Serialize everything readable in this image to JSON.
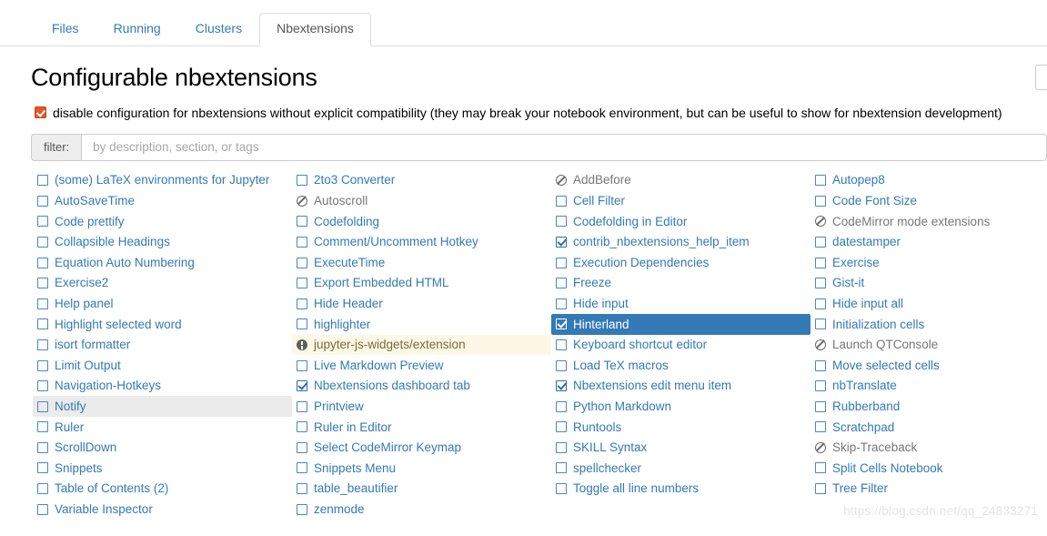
{
  "tabs": [
    {
      "label": "Files",
      "active": false
    },
    {
      "label": "Running",
      "active": false
    },
    {
      "label": "Clusters",
      "active": false
    },
    {
      "label": "Nbextensions",
      "active": true
    }
  ],
  "page": {
    "title": "Configurable nbextensions",
    "disable_config_label": "disable configuration for nbextensions without explicit compatibility (they may break your notebook environment, but can be useful to show for nbextension development)",
    "disable_config_checked": true
  },
  "filter": {
    "addon_label": "filter:",
    "placeholder": "by description, section, or tags",
    "value": ""
  },
  "colors": {
    "link": "#337ab7",
    "selected_bg": "#337ab7",
    "selected_fg": "#ffffff",
    "hover_bg": "#ebebeb",
    "warning_bg": "#fdf8e6",
    "orange_checkbox": "#e8562a",
    "incompatible_fg": "#777777"
  },
  "columns": [
    [
      {
        "label": "(some) LaTeX environments for Jupyter",
        "icon": "unchecked-box-icon",
        "state": "normal"
      },
      {
        "label": "AutoSaveTime",
        "icon": "unchecked-box-icon",
        "state": "normal"
      },
      {
        "label": "Code prettify",
        "icon": "unchecked-box-icon",
        "state": "normal"
      },
      {
        "label": "Collapsible Headings",
        "icon": "unchecked-box-icon",
        "state": "normal"
      },
      {
        "label": "Equation Auto Numbering",
        "icon": "unchecked-box-icon",
        "state": "normal"
      },
      {
        "label": "Exercise2",
        "icon": "unchecked-box-icon",
        "state": "normal"
      },
      {
        "label": "Help panel",
        "icon": "unchecked-box-icon",
        "state": "normal"
      },
      {
        "label": "Highlight selected word",
        "icon": "unchecked-box-icon",
        "state": "normal"
      },
      {
        "label": "isort formatter",
        "icon": "unchecked-box-icon",
        "state": "normal"
      },
      {
        "label": "Limit Output",
        "icon": "unchecked-box-icon",
        "state": "normal"
      },
      {
        "label": "Navigation-Hotkeys",
        "icon": "unchecked-box-icon",
        "state": "normal"
      },
      {
        "label": "Notify",
        "icon": "unchecked-box-icon",
        "state": "hovered"
      },
      {
        "label": "Ruler",
        "icon": "unchecked-box-icon",
        "state": "normal"
      },
      {
        "label": "ScrollDown",
        "icon": "unchecked-box-icon",
        "state": "normal"
      },
      {
        "label": "Snippets",
        "icon": "unchecked-box-icon",
        "state": "normal"
      },
      {
        "label": "Table of Contents (2)",
        "icon": "unchecked-box-icon",
        "state": "normal"
      },
      {
        "label": "Variable Inspector",
        "icon": "unchecked-box-icon",
        "state": "normal"
      }
    ],
    [
      {
        "label": "2to3 Converter",
        "icon": "unchecked-box-icon",
        "state": "normal"
      },
      {
        "label": "Autoscroll",
        "icon": "blocked-icon",
        "state": "incompatible"
      },
      {
        "label": "Codefolding",
        "icon": "unchecked-box-icon",
        "state": "normal"
      },
      {
        "label": "Comment/Uncomment Hotkey",
        "icon": "unchecked-box-icon",
        "state": "normal"
      },
      {
        "label": "ExecuteTime",
        "icon": "unchecked-box-icon",
        "state": "normal"
      },
      {
        "label": "Export Embedded HTML",
        "icon": "unchecked-box-icon",
        "state": "normal"
      },
      {
        "label": "Hide Header",
        "icon": "unchecked-box-icon",
        "state": "normal"
      },
      {
        "label": "highlighter",
        "icon": "unchecked-box-icon",
        "state": "normal"
      },
      {
        "label": "jupyter-js-widgets/extension",
        "icon": "warning-icon",
        "state": "warning"
      },
      {
        "label": "Live Markdown Preview",
        "icon": "unchecked-box-icon",
        "state": "normal"
      },
      {
        "label": "Nbextensions dashboard tab",
        "icon": "checked-box-icon",
        "state": "normal"
      },
      {
        "label": "Printview",
        "icon": "unchecked-box-icon",
        "state": "normal"
      },
      {
        "label": "Ruler in Editor",
        "icon": "unchecked-box-icon",
        "state": "normal"
      },
      {
        "label": "Select CodeMirror Keymap",
        "icon": "unchecked-box-icon",
        "state": "normal"
      },
      {
        "label": "Snippets Menu",
        "icon": "unchecked-box-icon",
        "state": "normal"
      },
      {
        "label": "table_beautifier",
        "icon": "unchecked-box-icon",
        "state": "normal"
      },
      {
        "label": "zenmode",
        "icon": "unchecked-box-icon",
        "state": "normal"
      }
    ],
    [
      {
        "label": "AddBefore",
        "icon": "blocked-icon",
        "state": "incompatible"
      },
      {
        "label": "Cell Filter",
        "icon": "unchecked-box-icon",
        "state": "normal"
      },
      {
        "label": "Codefolding in Editor",
        "icon": "unchecked-box-icon",
        "state": "normal"
      },
      {
        "label": "contrib_nbextensions_help_item",
        "icon": "checked-box-icon",
        "state": "normal"
      },
      {
        "label": "Execution Dependencies",
        "icon": "unchecked-box-icon",
        "state": "normal"
      },
      {
        "label": "Freeze",
        "icon": "unchecked-box-icon",
        "state": "normal"
      },
      {
        "label": "Hide input",
        "icon": "unchecked-box-icon",
        "state": "normal"
      },
      {
        "label": "Hinterland",
        "icon": "checked-box-icon",
        "state": "selected"
      },
      {
        "label": "Keyboard shortcut editor",
        "icon": "unchecked-box-icon",
        "state": "normal"
      },
      {
        "label": "Load TeX macros",
        "icon": "unchecked-box-icon",
        "state": "normal"
      },
      {
        "label": "Nbextensions edit menu item",
        "icon": "checked-box-icon",
        "state": "normal"
      },
      {
        "label": "Python Markdown",
        "icon": "unchecked-box-icon",
        "state": "normal"
      },
      {
        "label": "Runtools",
        "icon": "unchecked-box-icon",
        "state": "normal"
      },
      {
        "label": "SKILL Syntax",
        "icon": "unchecked-box-icon",
        "state": "normal"
      },
      {
        "label": "spellchecker",
        "icon": "unchecked-box-icon",
        "state": "normal"
      },
      {
        "label": "Toggle all line numbers",
        "icon": "unchecked-box-icon",
        "state": "normal"
      }
    ],
    [
      {
        "label": "Autopep8",
        "icon": "unchecked-box-icon",
        "state": "normal"
      },
      {
        "label": "Code Font Size",
        "icon": "unchecked-box-icon",
        "state": "normal"
      },
      {
        "label": "CodeMirror mode extensions",
        "icon": "blocked-icon",
        "state": "incompatible"
      },
      {
        "label": "datestamper",
        "icon": "unchecked-box-icon",
        "state": "normal"
      },
      {
        "label": "Exercise",
        "icon": "unchecked-box-icon",
        "state": "normal"
      },
      {
        "label": "Gist-it",
        "icon": "unchecked-box-icon",
        "state": "normal"
      },
      {
        "label": "Hide input all",
        "icon": "unchecked-box-icon",
        "state": "normal"
      },
      {
        "label": "Initialization cells",
        "icon": "unchecked-box-icon",
        "state": "normal"
      },
      {
        "label": "Launch QTConsole",
        "icon": "blocked-icon",
        "state": "incompatible"
      },
      {
        "label": "Move selected cells",
        "icon": "unchecked-box-icon",
        "state": "normal"
      },
      {
        "label": "nbTranslate",
        "icon": "unchecked-box-icon",
        "state": "normal"
      },
      {
        "label": "Rubberband",
        "icon": "unchecked-box-icon",
        "state": "normal"
      },
      {
        "label": "Scratchpad",
        "icon": "unchecked-box-icon",
        "state": "normal"
      },
      {
        "label": "Skip-Traceback",
        "icon": "blocked-icon",
        "state": "incompatible"
      },
      {
        "label": "Split Cells Notebook",
        "icon": "unchecked-box-icon",
        "state": "normal"
      },
      {
        "label": "Tree Filter",
        "icon": "unchecked-box-icon",
        "state": "normal"
      }
    ]
  ],
  "watermark": "https://blog.csdn.net/qq_24833271"
}
